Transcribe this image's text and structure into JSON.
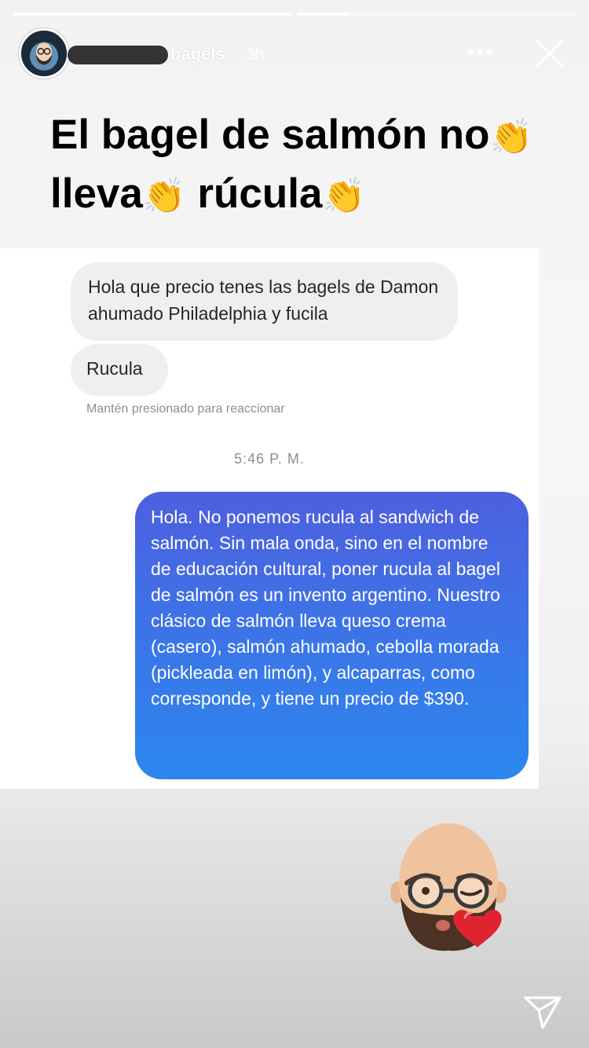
{
  "story": {
    "progress": [
      1.0,
      0.18
    ]
  },
  "header": {
    "username": "bagels",
    "time_ago": "3h",
    "more_label": "•••",
    "avatar_icon": "profile-avatar-icon",
    "close_icon": "close-icon"
  },
  "headline": {
    "line1": "El bagel de salmón no",
    "clap": "👏",
    "line2a": "lleva",
    "line2b": "rúcula"
  },
  "chat": {
    "incoming": [
      "Hola que precio tenes las bagels de Damon ahumado Philadelphia y fucila",
      "Rucula"
    ],
    "hint": "Mantén presionado para reaccionar",
    "timestamp": "5:46 P. M.",
    "outgoing": "Hola. No ponemos rucula al sandwich de salmón. Sin mala onda, sino en el nombre de educación cultural, poner rucula al bagel de salmón es un invento argentino. Nuestro clásico de salmón lleva queso crema (casero), salmón ahumado, cebolla morada (pickleada en limón), y alcaparras, como corresponde, y tiene un precio de $390."
  },
  "footer": {
    "memoji_icon": "memoji-kiss-sticker-icon",
    "send_icon": "send-paper-plane-icon"
  },
  "colors": {
    "outgoing_top": "#4e5fde",
    "outgoing_bottom": "#2b87ee",
    "incoming_bg": "#efefef"
  }
}
